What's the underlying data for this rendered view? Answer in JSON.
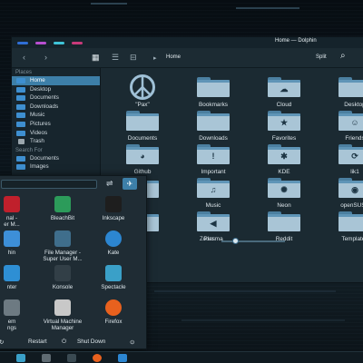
{
  "window": {
    "title": "Home — Dolphin",
    "breadcrumb": "Home",
    "split_label": "Split",
    "titlebar_colors": [
      "#2f6fd6",
      "#b84fd0",
      "#3fc4d8",
      "#c73a7a"
    ]
  },
  "toolbar": {
    "back": "‹",
    "forward": "›",
    "view_icons": "▦",
    "view_compact": "☰",
    "view_details": "⊟",
    "crumb_arrow": "▸",
    "search": "⌕"
  },
  "sidebar": {
    "places_header": "Places",
    "places": [
      {
        "label": "Home",
        "selected": true
      },
      {
        "label": "Desktop"
      },
      {
        "label": "Documents"
      },
      {
        "label": "Downloads"
      },
      {
        "label": "Music"
      },
      {
        "label": "Pictures"
      },
      {
        "label": "Videos"
      },
      {
        "label": "Trash"
      }
    ],
    "search_header": "Search For",
    "search_items": [
      {
        "label": "Documents"
      },
      {
        "label": "Images"
      }
    ]
  },
  "folders": [
    {
      "label": "\"Pax\"",
      "icon": "peace-icon"
    },
    {
      "label": "Bookmarks",
      "icon": "folder-icon"
    },
    {
      "label": "Cloud",
      "icon": "cloud-folder-icon",
      "emblem": "☁"
    },
    {
      "label": "Desktop",
      "icon": "desktop-folder-icon"
    },
    {
      "label": "Documents",
      "icon": "folder-icon"
    },
    {
      "label": "Downloads",
      "icon": "folder-icon"
    },
    {
      "label": "Favorites",
      "icon": "favorites-folder-icon",
      "emblem": "★"
    },
    {
      "label": "Friends",
      "icon": "friends-folder-icon",
      "emblem": "☺"
    },
    {
      "label": "Github",
      "icon": "github-folder-icon",
      "emblem": "◕"
    },
    {
      "label": "Important",
      "icon": "important-folder-icon",
      "emblem": "!"
    },
    {
      "label": "KDE",
      "icon": "kde-folder-icon",
      "emblem": "✱"
    },
    {
      "label": "lik1",
      "icon": "link-folder-icon",
      "emblem": "⟳"
    },
    {
      "label": "",
      "icon": "folder-icon"
    },
    {
      "label": "Music",
      "icon": "music-folder-icon",
      "emblem": "♫"
    },
    {
      "label": "Neon",
      "icon": "neon-folder-icon",
      "emblem": "✺"
    },
    {
      "label": "openSUSE",
      "icon": "opensuse-folder-icon",
      "emblem": "◉"
    },
    {
      "label": "",
      "icon": "folder-icon"
    },
    {
      "label": "Plasma",
      "icon": "plasma-folder-icon",
      "emblem": "◀"
    },
    {
      "label": "Reddit",
      "icon": "folder-icon"
    },
    {
      "label": "Templates",
      "icon": "templates-folder-icon"
    }
  ],
  "zoom": {
    "label": "Zoom:",
    "level": 0.22
  },
  "launcher": {
    "apps": [
      {
        "label": "nal -",
        "label2": "er M...",
        "icon": "terminal-icon",
        "color": "#c0202c"
      },
      {
        "label": "BleachBit",
        "label2": "",
        "icon": "bleachbit-icon",
        "color": "#2c9b5a"
      },
      {
        "label": "Inkscape",
        "label2": "",
        "icon": "inkscape-icon",
        "color": "#1e1e1e"
      },
      {
        "label": "hin",
        "label2": "",
        "icon": "dolphin-icon",
        "color": "#3d8fd8"
      },
      {
        "label": "File Manager -",
        "label2": "Super User M...",
        "icon": "file-manager-icon",
        "color": "#3f6e8c"
      },
      {
        "label": "Kate",
        "label2": "",
        "icon": "kate-icon",
        "color": "#2c86d1"
      },
      {
        "label": "nter",
        "label2": "",
        "icon": "printer-icon",
        "color": "#2e8fd4"
      },
      {
        "label": "Konsole",
        "label2": "",
        "icon": "konsole-icon",
        "color": "#323f47"
      },
      {
        "label": "Spectacle",
        "label2": "",
        "icon": "spectacle-icon",
        "color": "#3aa0c8"
      },
      {
        "label": "em",
        "label2": "ngs",
        "icon": "system-settings-icon",
        "color": "#6d7a82"
      },
      {
        "label": "Virtual Machine",
        "label2": "Manager",
        "icon": "virt-manager-icon",
        "color": "#c8c8c8"
      },
      {
        "label": "Firefox",
        "label2": "",
        "icon": "firefox-icon",
        "color": "#e8611e"
      }
    ],
    "power": {
      "restart": "Restart",
      "shutdown": "Shut Down"
    }
  },
  "taskbar": {
    "icons": [
      {
        "icon": "app-icon-1",
        "color": "#3aa0c8"
      },
      {
        "icon": "app-icon-2",
        "color": "#5f6b72"
      },
      {
        "icon": "app-icon-3",
        "color": "#3a4a52"
      },
      {
        "icon": "firefox-icon",
        "color": "#e8611e"
      },
      {
        "icon": "app-icon-5",
        "color": "#2c86d1"
      }
    ]
  }
}
